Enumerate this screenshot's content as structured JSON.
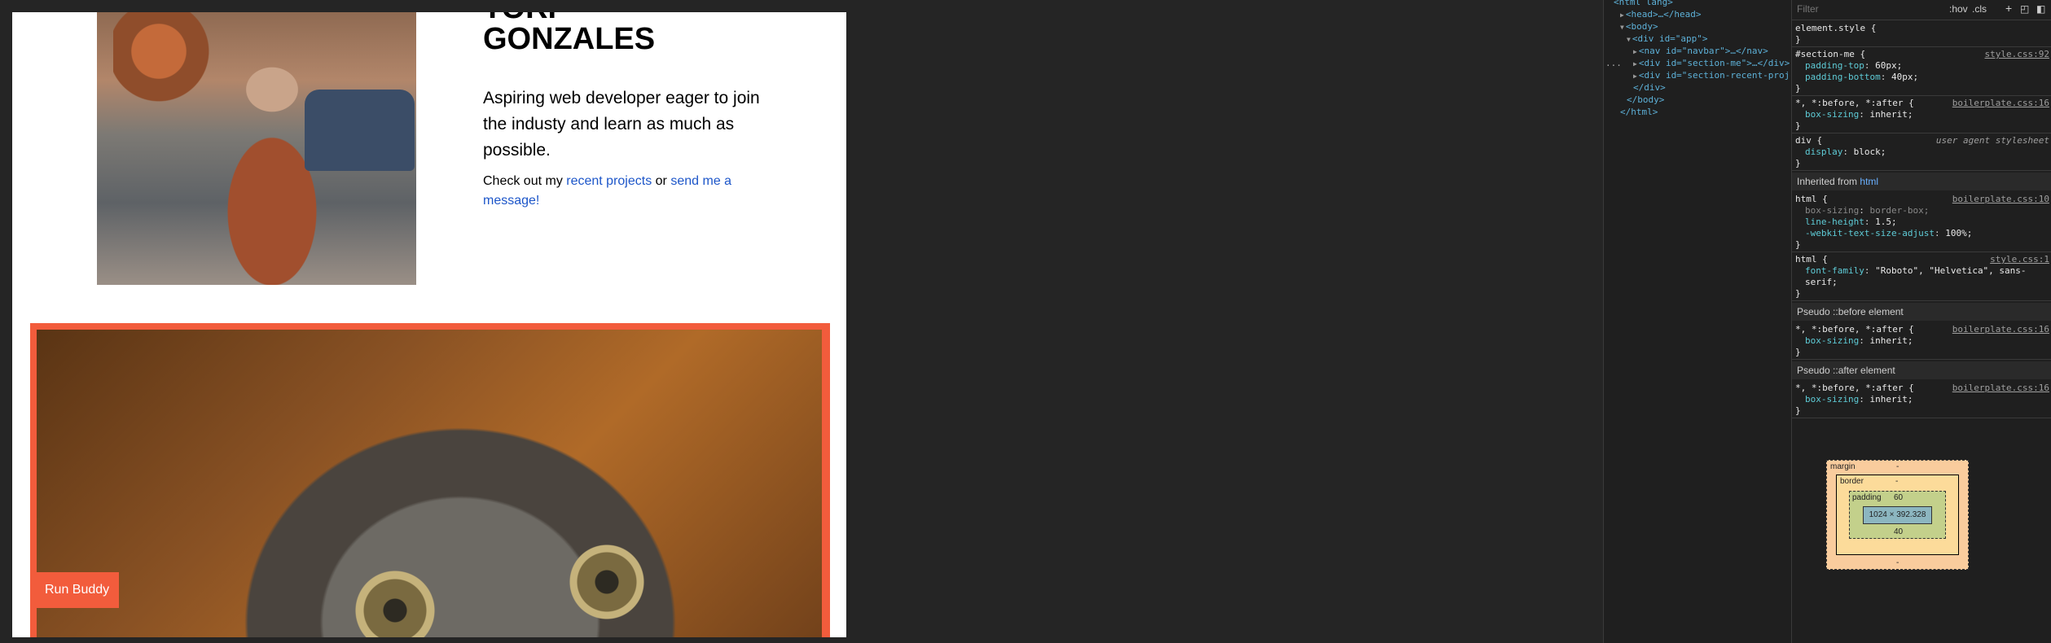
{
  "page": {
    "first_name_partial": "TORI",
    "last_name": "GONZALES",
    "tagline": "Aspiring web developer eager to join the industy and learn as much as possible.",
    "cta_prefix": "Check out my",
    "cta_link1": "recent projects",
    "cta_mid": "or",
    "cta_link2": "send me a message!",
    "project_label": "Run Buddy",
    "colors": {
      "accent": "#f25c3c",
      "link": "#1d56c9"
    }
  },
  "devtools": {
    "elements": {
      "lines": [
        {
          "indent": 0,
          "text": "<html lang>"
        },
        {
          "indent": 1,
          "open": "▶",
          "text": "<head>…</head>"
        },
        {
          "indent": 1,
          "open": "▼",
          "text": "<body>"
        },
        {
          "indent": 2,
          "open": "▼",
          "text": "<div id=\"app\">"
        },
        {
          "indent": 3,
          "open": "▶",
          "text": "<nav id=\"navbar\">…</nav>"
        },
        {
          "indent": 3,
          "open": "▶",
          "text": "<div id=\"section-me\">…</div>",
          "selected": true
        },
        {
          "indent": 3,
          "open": "▶",
          "text": "<div id=\"section-recent-projects\">…</div>"
        },
        {
          "indent": 3,
          "text": "</div>"
        },
        {
          "indent": 2,
          "text": "</body>"
        },
        {
          "indent": 1,
          "text": "</html>"
        }
      ],
      "selected_marker": "..."
    },
    "styles": {
      "filter_placeholder": "Filter",
      "hov_label": ":hov",
      "cls_label": ".cls",
      "plus_label": "+",
      "rules": [
        {
          "selector": "element.style {",
          "source": "",
          "props": [],
          "close": "}"
        },
        {
          "selector": "#section-me {",
          "source": "style.css:92",
          "props": [
            {
              "name": "padding-top",
              "value": "60px;"
            },
            {
              "name": "padding-bottom",
              "value": "40px;"
            }
          ],
          "close": "}"
        },
        {
          "selector": "*, *:before, *:after {",
          "source": "boilerplate.css:16",
          "props": [
            {
              "name": "box-sizing",
              "value": "inherit;"
            }
          ],
          "close": "}"
        },
        {
          "selector": "div {",
          "source": "user agent stylesheet",
          "props": [
            {
              "name": "display",
              "value": "block;"
            }
          ],
          "close": "}"
        }
      ],
      "inherited_label": "Inherited from",
      "inherited_from": "html",
      "inherited_rules": [
        {
          "selector": "html {",
          "source": "boilerplate.css:10",
          "props": [
            {
              "name": "box-sizing",
              "value": "border-box;"
            },
            {
              "name": "line-height",
              "value": "1.5;"
            },
            {
              "name": "-webkit-text-size-adjust",
              "value": "100%;"
            }
          ],
          "close": "}"
        },
        {
          "selector": "html {",
          "source": "style.css:1",
          "props": [
            {
              "name": "font-family",
              "value": "\"Roboto\", \"Helvetica\", sans-"
            },
            {
              "name": "",
              "value": "serif;"
            }
          ],
          "close": "}"
        }
      ],
      "pseudo_before_label": "Pseudo ::before element",
      "pseudo_before_rule": {
        "selector": "*, *:before, *:after {",
        "source": "boilerplate.css:16",
        "prop": "box-sizing",
        "value": "inherit;",
        "close": "}"
      },
      "pseudo_after_label": "Pseudo ::after element",
      "pseudo_after_rule": {
        "selector": "*, *:before, *:after {",
        "source": "boilerplate.css:16",
        "prop": "box-sizing",
        "value": "inherit;",
        "close": "}"
      }
    },
    "box_model": {
      "margin_label": "margin",
      "margin_value": "-",
      "border_label": "border",
      "border_value": "-",
      "padding_label": "padding",
      "padding_top": "60",
      "padding_bottom": "40",
      "padding_side": "-",
      "content": "1024 × 392.328"
    }
  }
}
